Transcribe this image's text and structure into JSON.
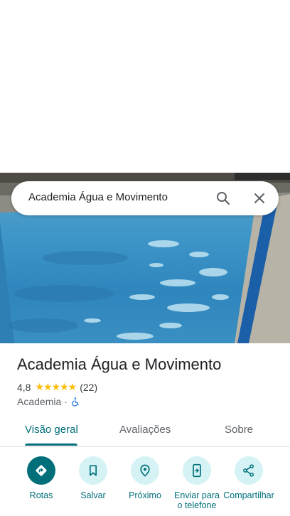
{
  "search": {
    "query": "Academia Água e Movimento"
  },
  "place": {
    "name": "Academia Água e Movimento",
    "rating": "4,8",
    "stars": "★★★★★",
    "review_count": "(22)",
    "category": "Academia",
    "separator": "·",
    "accessibility_icon": "wheelchair-icon"
  },
  "tabs": [
    {
      "label": "Visão geral",
      "active": true
    },
    {
      "label": "Avaliações",
      "active": false
    },
    {
      "label": "Sobre",
      "active": false
    }
  ],
  "actions": [
    {
      "label": "Rotas",
      "icon": "directions-icon"
    },
    {
      "label": "Salvar",
      "icon": "bookmark-icon"
    },
    {
      "label": "Próximo",
      "icon": "nearby-icon"
    },
    {
      "label": "Enviar para o telefone",
      "icon": "send-to-phone-icon"
    },
    {
      "label": "Compartilhar",
      "icon": "share-icon"
    }
  ],
  "colors": {
    "accent": "#006f7a",
    "action_bg": "#d5f3f5",
    "star": "#fbbc04",
    "accessibility": "#1a73e8"
  }
}
